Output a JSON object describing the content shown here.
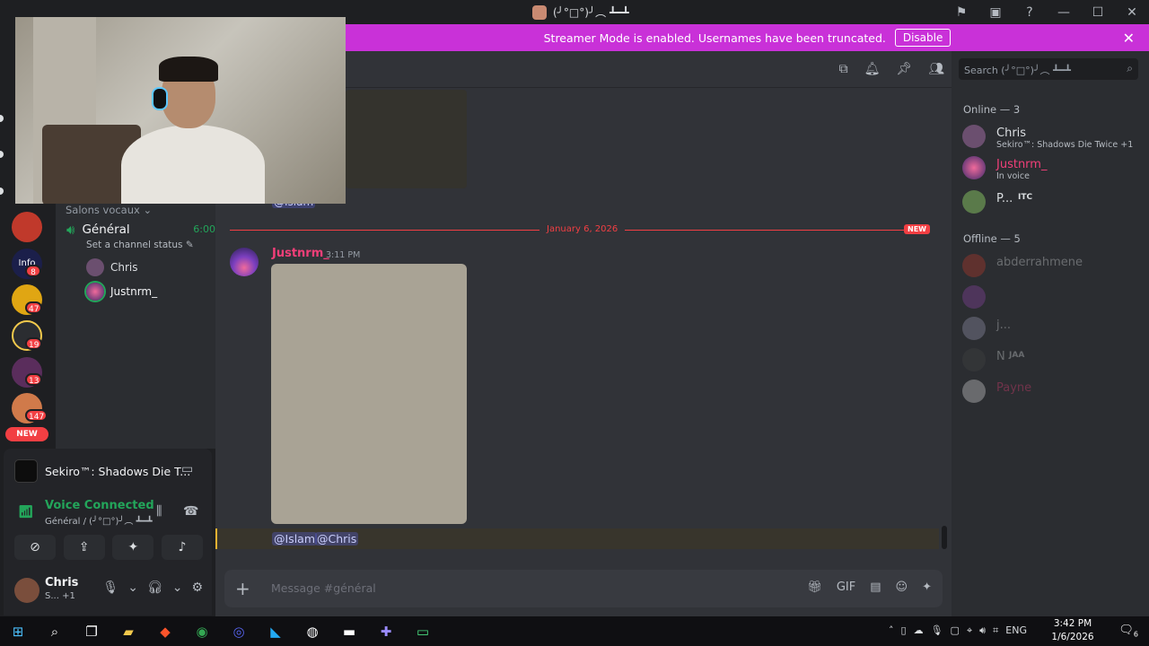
{
  "window": {
    "title": "(╯°□°)╯︵ ┻━┻"
  },
  "banner": {
    "text": "Streamer Mode is enabled. Usernames have been truncated.",
    "button": "Disable"
  },
  "rail": {
    "badges": [
      "8",
      "47",
      "19",
      "13",
      "147"
    ],
    "new_label": "NEW",
    "info_label": "Info"
  },
  "sidebar": {
    "category": "Salons vocaux",
    "channel": "Général",
    "channel_time": "6:00",
    "status_placeholder": "Set a channel status",
    "voice_users": [
      "Chris",
      "Justnrm_"
    ]
  },
  "activity": {
    "game": "Sekiro™: Shadows Die T...",
    "voice_status": "Voice Connected",
    "voice_channel": "Général / (╯°□°)╯︵ ┻━┻"
  },
  "user": {
    "name": "Chris",
    "status": "S...",
    "extra": "+1"
  },
  "chat": {
    "old_mention": "@Islam",
    "divider_date": "January 6, 2026",
    "new_label": "NEW",
    "author": "Justnrm_",
    "time": "3:11 PM",
    "mentions": [
      "@Islam",
      "@Chris"
    ],
    "placeholder": "Message #général"
  },
  "members": {
    "search_placeholder": "Search (╯°□°)╯︵ ┻━┻",
    "online_header": "Online — 3",
    "offline_header": "Offline — 5",
    "online": [
      {
        "name": "Chris",
        "status": "Sekiro™: Shadows Die Twice +1",
        "color": "#dbdee1"
      },
      {
        "name": "Justnrm_",
        "status": "In voice",
        "color": "#f23f79"
      },
      {
        "name": "P...",
        "status": "",
        "tag": "ITC",
        "color": "#dbdee1"
      }
    ],
    "offline": [
      {
        "name": "abderrahmene",
        "color": "#dbdee1"
      },
      {
        "name": "",
        "color": "#f23f43"
      },
      {
        "name": "j...",
        "color": "#dbdee1"
      },
      {
        "name": "N",
        "tag": "JAA",
        "color": "#dbdee1"
      },
      {
        "name": "Payne",
        "color": "#f23f79"
      }
    ]
  },
  "taskbar": {
    "lang": "ENG",
    "time": "3:42 PM",
    "date": "1/6/2026",
    "notif_count": "6"
  },
  "colors": {
    "accent": "#5865f2",
    "green": "#23a55a",
    "red": "#f23f43",
    "banner": "#c931d8"
  }
}
